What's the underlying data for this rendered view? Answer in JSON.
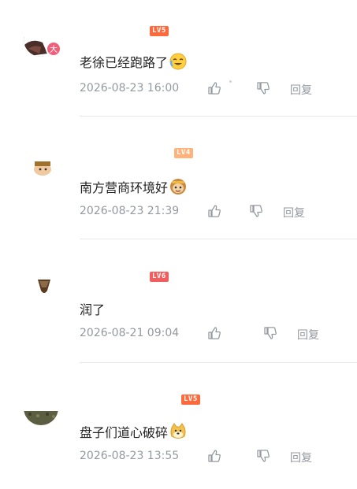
{
  "comments": [
    {
      "level": "LV5",
      "level_color": "#ff6a3d",
      "avatar_badge": "大",
      "text": "老徐已经跑路了",
      "emoji": "laughing-crying-emoji",
      "time": "2026-08-23 16:00",
      "reply": "回复"
    },
    {
      "level": "LV4",
      "level_color": "#ffb27a",
      "text": "南方营商环境好",
      "emoji": "monkey-emoji",
      "time": "2026-08-23 21:39",
      "reply": "回复"
    },
    {
      "level": "LV6",
      "level_color": "#f25d5d",
      "text": "润了",
      "time": "2026-08-21 09:04",
      "reply": "回复"
    },
    {
      "level": "LV5",
      "level_color": "#ff6a3d",
      "text": "盘子们道心破碎",
      "emoji": "doge-emoji",
      "time": "2026-08-23 13:55",
      "reply": "回复"
    }
  ]
}
